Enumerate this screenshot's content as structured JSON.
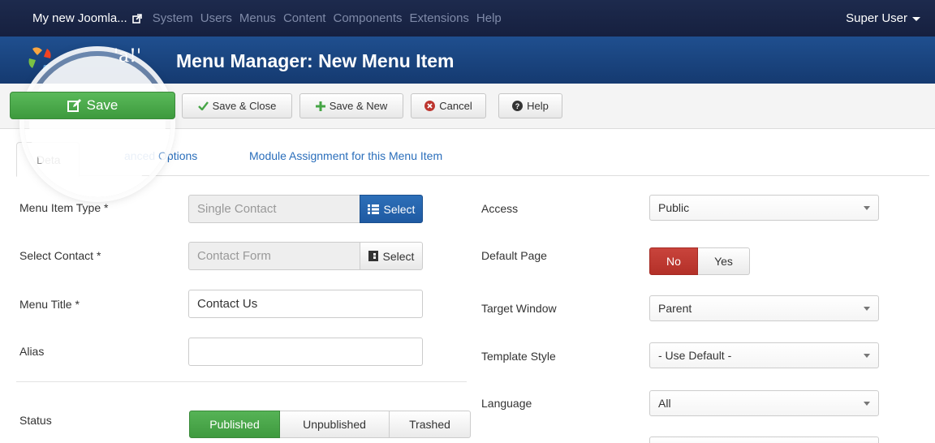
{
  "navbar": {
    "site_title": "My new Joomla...",
    "menus": [
      "System",
      "Users",
      "Menus",
      "Content",
      "Components",
      "Extensions",
      "Help"
    ],
    "user": "Super User"
  },
  "header": {
    "logo_text": "エ ·· ' · ·· ′ˈ····",
    "logo_word": "'a!'",
    "title": "Menu Manager: New Menu Item"
  },
  "toolbar": {
    "save": "Save",
    "save_close": "Save & Close",
    "save_new": "Save & New",
    "cancel": "Cancel",
    "help": "Help"
  },
  "tabs": {
    "details": "Deta",
    "advanced": "anced Options",
    "module": "Module Assignment for this Menu Item"
  },
  "form": {
    "menu_item_type": {
      "label": "Menu Item Type *",
      "value": "Single Contact",
      "button": "Select"
    },
    "select_contact": {
      "label": "Select Contact *",
      "value": "Contact Form",
      "button": "Select"
    },
    "menu_title": {
      "label": "Menu Title *",
      "value": "Contact Us"
    },
    "alias": {
      "label": "Alias",
      "value": ""
    },
    "status": {
      "label": "Status",
      "options": [
        "Published",
        "Unpublished",
        "Trashed"
      ],
      "selected": "Published"
    },
    "access": {
      "label": "Access",
      "value": "Public"
    },
    "default_page": {
      "label": "Default Page",
      "options": [
        "No",
        "Yes"
      ],
      "selected": "No"
    },
    "target_window": {
      "label": "Target Window",
      "value": "Parent"
    },
    "template_style": {
      "label": "Template Style",
      "value": "- Use Default -"
    },
    "language": {
      "label": "Language",
      "value": "All"
    }
  },
  "colors": {
    "navbar": "#1d2a4d",
    "header": "#1f4f8f",
    "save_green": "#46a546",
    "primary_blue": "#2d6fb8",
    "no_red": "#bd362f",
    "link_blue": "#2a6ebb"
  }
}
